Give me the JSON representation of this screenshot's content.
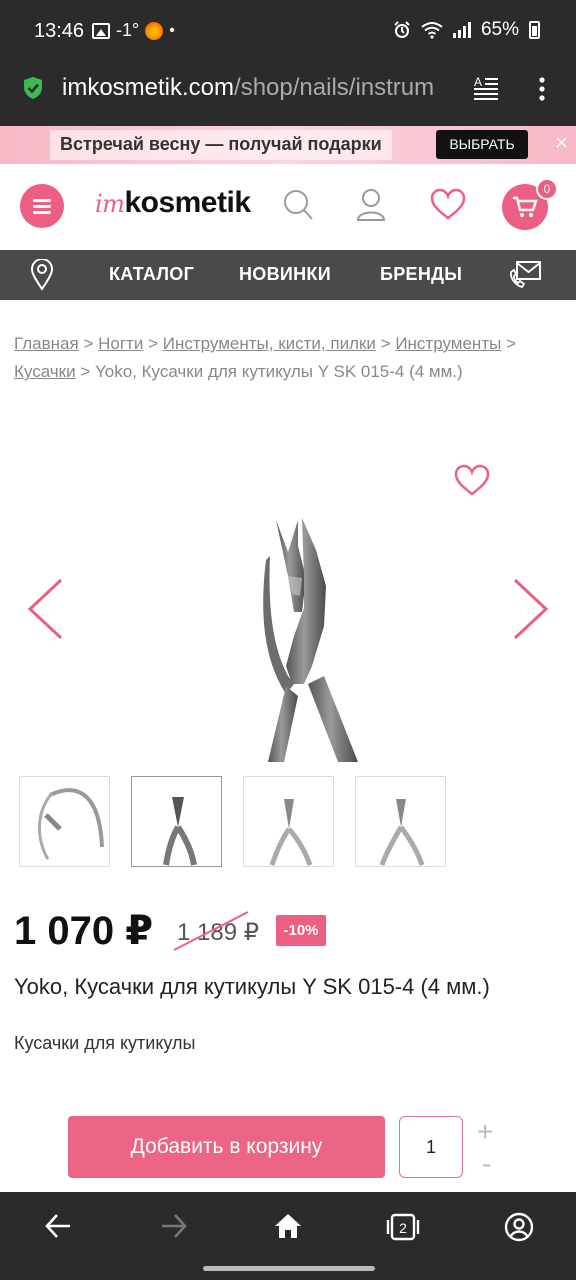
{
  "status_bar": {
    "time": "13:46",
    "temperature": "-1°",
    "separator": "•",
    "battery": "65%"
  },
  "browser": {
    "url_domain": "imkosmetik.com",
    "url_path": "/shop/nails/instrum"
  },
  "promo": {
    "text": "Встречай весну — получай подарки",
    "button": "ВЫБРАТЬ",
    "close": "×"
  },
  "header": {
    "logo_im": "im",
    "logo_main": "kosmetik",
    "cart_count": "0"
  },
  "nav": {
    "items": [
      "КАТАЛОГ",
      "НОВИНКИ",
      "БРЕНДЫ"
    ]
  },
  "breadcrumbs": {
    "links": [
      "Главная",
      "Ногти",
      "Инструменты, кисти, пилки",
      "Инструменты",
      "Кусачки"
    ],
    "separator": ">",
    "current": "Yoko, Кусачки для кутикулы Y SK 015-4 (4 мм.)"
  },
  "product": {
    "price": "1 070 ₽",
    "old_price": "1 189 ₽",
    "discount": "-10%",
    "title": "Yoko, Кусачки для кутикулы Y SK 015-4 (4 мм.)",
    "description": "Кусачки для кутикулы",
    "selected_thumbnail": 2
  },
  "cart_actions": {
    "add_button": "Добавить в корзину",
    "quantity": "1",
    "plus": "+",
    "minus": "-"
  },
  "colors": {
    "accent": "#ec5f82",
    "dark_bar": "#2b2b2b",
    "nav_bar": "#4a4a4a"
  }
}
